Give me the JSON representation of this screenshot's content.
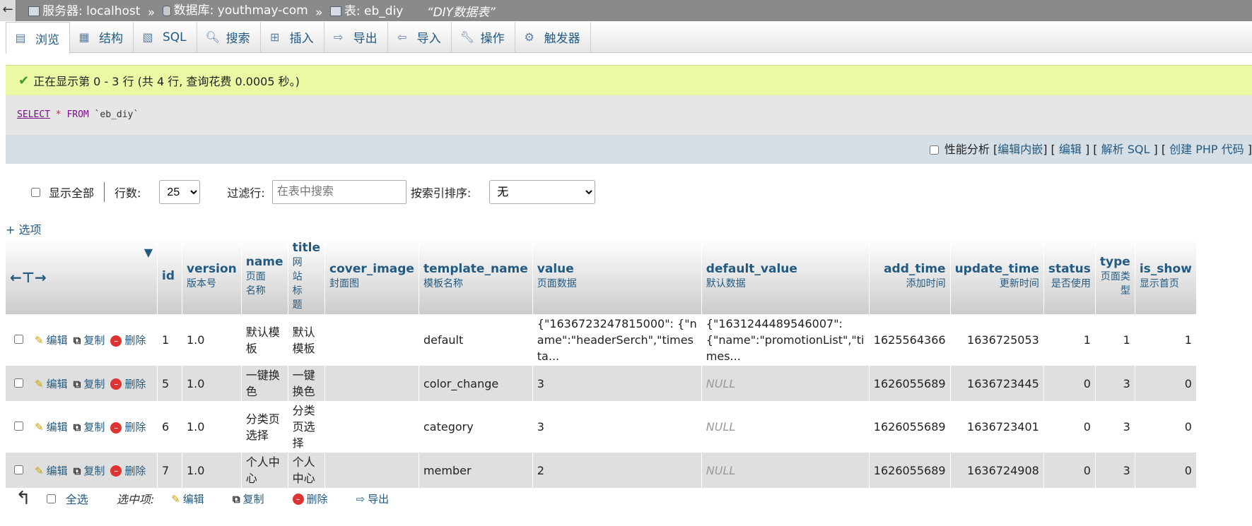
{
  "breadcrumb": {
    "server": "服务器: localhost",
    "database": "数据库: youthmay-com",
    "table": "表: eb_diy",
    "table_comment": "“DIY数据表”",
    "separator": "»"
  },
  "tabs": [
    {
      "label": "浏览",
      "icon": "browse-icon",
      "active": true
    },
    {
      "label": "结构",
      "icon": "structure-icon"
    },
    {
      "label": "SQL",
      "icon": "sql-icon"
    },
    {
      "label": "搜索",
      "icon": "search-icon"
    },
    {
      "label": "插入",
      "icon": "insert-icon"
    },
    {
      "label": "导出",
      "icon": "export-icon"
    },
    {
      "label": "导入",
      "icon": "import-icon"
    },
    {
      "label": "操作",
      "icon": "operations-icon"
    },
    {
      "label": "触发器",
      "icon": "triggers-icon"
    }
  ],
  "message": "正在显示第 0 - 3 行 (共 4 行, 查询花费 0.0005 秒。)",
  "sql": {
    "select": "SELECT",
    "star": "*",
    "from": "FROM",
    "table": "`eb_diy`"
  },
  "sql_options": {
    "profiling": "性能分析",
    "edit_inline": "编辑内嵌",
    "edit": "编辑",
    "explain": "解析 SQL",
    "php": "创建 PHP 代码"
  },
  "nav": {
    "show_all": "显示全部",
    "rows_label": "行数:",
    "rows_value": "25",
    "filter_label": "过滤行:",
    "filter_placeholder": "在表中搜索",
    "sort_label": "按索引排序:",
    "sort_value": "无"
  },
  "options_link": "+ 选项",
  "columns": [
    {
      "name": "id",
      "comment": ""
    },
    {
      "name": "version",
      "comment": "版本号"
    },
    {
      "name": "name",
      "comment": "页面名称"
    },
    {
      "name": "title",
      "comment": "网站标题"
    },
    {
      "name": "cover_image",
      "comment": "封面图"
    },
    {
      "name": "template_name",
      "comment": "模板名称"
    },
    {
      "name": "value",
      "comment": "页面数据"
    },
    {
      "name": "default_value",
      "comment": "默认数据"
    },
    {
      "name": "add_time",
      "comment": "添加时间"
    },
    {
      "name": "update_time",
      "comment": "更新时间"
    },
    {
      "name": "status",
      "comment": "是否使用"
    },
    {
      "name": "type",
      "comment": "页面类型"
    },
    {
      "name": "is_show",
      "comment": "显示首页"
    }
  ],
  "row_actions": {
    "edit": "编辑",
    "copy": "复制",
    "delete": "删除"
  },
  "rows": [
    {
      "id": "1",
      "version": "1.0",
      "name": "默认模板",
      "title": "默认模板",
      "cover_image": "",
      "template_name": "default",
      "value": "{\"1636723247815000\": {\"name\":\"headerSerch\",\"timesta...",
      "default_value": "{\"1631244489546007\": {\"name\":\"promotionList\",\"times...",
      "add_time": "1625564366",
      "update_time": "1636725053",
      "status": "1",
      "type": "1",
      "is_show": "1"
    },
    {
      "id": "5",
      "version": "1.0",
      "name": "一键换色",
      "title": "一键换色",
      "cover_image": "",
      "template_name": "color_change",
      "value": "3",
      "default_value": "NULL",
      "add_time": "1626055689",
      "update_time": "1636723445",
      "status": "0",
      "type": "3",
      "is_show": "0"
    },
    {
      "id": "6",
      "version": "1.0",
      "name": "分类页选择",
      "title": "分类页选择",
      "cover_image": "",
      "template_name": "category",
      "value": "3",
      "default_value": "NULL",
      "add_time": "1626055689",
      "update_time": "1636723401",
      "status": "0",
      "type": "3",
      "is_show": "0"
    },
    {
      "id": "7",
      "version": "1.0",
      "name": "个人中心",
      "title": "个人中心",
      "cover_image": "",
      "template_name": "member",
      "value": "2",
      "default_value": "NULL",
      "add_time": "1626055689",
      "update_time": "1636724908",
      "status": "0",
      "type": "3",
      "is_show": "0"
    }
  ],
  "footer": {
    "select_all": "全选",
    "with_selected": "选中项:",
    "edit": "编辑",
    "copy": "复制",
    "delete": "删除",
    "export": "导出"
  }
}
